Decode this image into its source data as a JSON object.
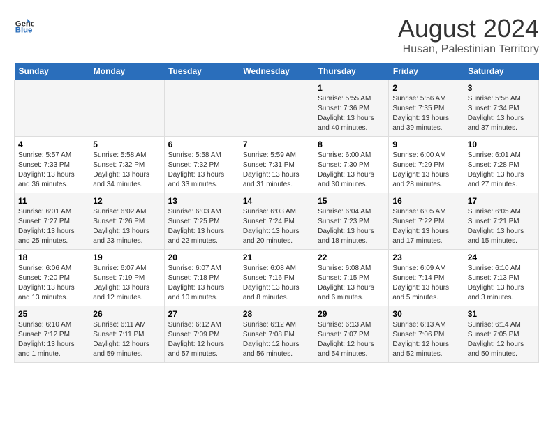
{
  "header": {
    "logo_general": "General",
    "logo_blue": "Blue",
    "main_title": "August 2024",
    "subtitle": "Husan, Palestinian Territory"
  },
  "weekdays": [
    "Sunday",
    "Monday",
    "Tuesday",
    "Wednesday",
    "Thursday",
    "Friday",
    "Saturday"
  ],
  "weeks": [
    [
      {
        "day": "",
        "sunrise": "",
        "sunset": "",
        "daylight": "",
        "empty": true
      },
      {
        "day": "",
        "sunrise": "",
        "sunset": "",
        "daylight": "",
        "empty": true
      },
      {
        "day": "",
        "sunrise": "",
        "sunset": "",
        "daylight": "",
        "empty": true
      },
      {
        "day": "",
        "sunrise": "",
        "sunset": "",
        "daylight": "",
        "empty": true
      },
      {
        "day": "1",
        "sunrise": "5:55 AM",
        "sunset": "7:36 PM",
        "daylight": "13 hours and 40 minutes.",
        "empty": false
      },
      {
        "day": "2",
        "sunrise": "5:56 AM",
        "sunset": "7:35 PM",
        "daylight": "13 hours and 39 minutes.",
        "empty": false
      },
      {
        "day": "3",
        "sunrise": "5:56 AM",
        "sunset": "7:34 PM",
        "daylight": "13 hours and 37 minutes.",
        "empty": false
      }
    ],
    [
      {
        "day": "4",
        "sunrise": "5:57 AM",
        "sunset": "7:33 PM",
        "daylight": "13 hours and 36 minutes.",
        "empty": false
      },
      {
        "day": "5",
        "sunrise": "5:58 AM",
        "sunset": "7:32 PM",
        "daylight": "13 hours and 34 minutes.",
        "empty": false
      },
      {
        "day": "6",
        "sunrise": "5:58 AM",
        "sunset": "7:32 PM",
        "daylight": "13 hours and 33 minutes.",
        "empty": false
      },
      {
        "day": "7",
        "sunrise": "5:59 AM",
        "sunset": "7:31 PM",
        "daylight": "13 hours and 31 minutes.",
        "empty": false
      },
      {
        "day": "8",
        "sunrise": "6:00 AM",
        "sunset": "7:30 PM",
        "daylight": "13 hours and 30 minutes.",
        "empty": false
      },
      {
        "day": "9",
        "sunrise": "6:00 AM",
        "sunset": "7:29 PM",
        "daylight": "13 hours and 28 minutes.",
        "empty": false
      },
      {
        "day": "10",
        "sunrise": "6:01 AM",
        "sunset": "7:28 PM",
        "daylight": "13 hours and 27 minutes.",
        "empty": false
      }
    ],
    [
      {
        "day": "11",
        "sunrise": "6:01 AM",
        "sunset": "7:27 PM",
        "daylight": "13 hours and 25 minutes.",
        "empty": false
      },
      {
        "day": "12",
        "sunrise": "6:02 AM",
        "sunset": "7:26 PM",
        "daylight": "13 hours and 23 minutes.",
        "empty": false
      },
      {
        "day": "13",
        "sunrise": "6:03 AM",
        "sunset": "7:25 PM",
        "daylight": "13 hours and 22 minutes.",
        "empty": false
      },
      {
        "day": "14",
        "sunrise": "6:03 AM",
        "sunset": "7:24 PM",
        "daylight": "13 hours and 20 minutes.",
        "empty": false
      },
      {
        "day": "15",
        "sunrise": "6:04 AM",
        "sunset": "7:23 PM",
        "daylight": "13 hours and 18 minutes.",
        "empty": false
      },
      {
        "day": "16",
        "sunrise": "6:05 AM",
        "sunset": "7:22 PM",
        "daylight": "13 hours and 17 minutes.",
        "empty": false
      },
      {
        "day": "17",
        "sunrise": "6:05 AM",
        "sunset": "7:21 PM",
        "daylight": "13 hours and 15 minutes.",
        "empty": false
      }
    ],
    [
      {
        "day": "18",
        "sunrise": "6:06 AM",
        "sunset": "7:20 PM",
        "daylight": "13 hours and 13 minutes.",
        "empty": false
      },
      {
        "day": "19",
        "sunrise": "6:07 AM",
        "sunset": "7:19 PM",
        "daylight": "13 hours and 12 minutes.",
        "empty": false
      },
      {
        "day": "20",
        "sunrise": "6:07 AM",
        "sunset": "7:18 PM",
        "daylight": "13 hours and 10 minutes.",
        "empty": false
      },
      {
        "day": "21",
        "sunrise": "6:08 AM",
        "sunset": "7:16 PM",
        "daylight": "13 hours and 8 minutes.",
        "empty": false
      },
      {
        "day": "22",
        "sunrise": "6:08 AM",
        "sunset": "7:15 PM",
        "daylight": "13 hours and 6 minutes.",
        "empty": false
      },
      {
        "day": "23",
        "sunrise": "6:09 AM",
        "sunset": "7:14 PM",
        "daylight": "13 hours and 5 minutes.",
        "empty": false
      },
      {
        "day": "24",
        "sunrise": "6:10 AM",
        "sunset": "7:13 PM",
        "daylight": "13 hours and 3 minutes.",
        "empty": false
      }
    ],
    [
      {
        "day": "25",
        "sunrise": "6:10 AM",
        "sunset": "7:12 PM",
        "daylight": "13 hours and 1 minute.",
        "empty": false
      },
      {
        "day": "26",
        "sunrise": "6:11 AM",
        "sunset": "7:11 PM",
        "daylight": "12 hours and 59 minutes.",
        "empty": false
      },
      {
        "day": "27",
        "sunrise": "6:12 AM",
        "sunset": "7:09 PM",
        "daylight": "12 hours and 57 minutes.",
        "empty": false
      },
      {
        "day": "28",
        "sunrise": "6:12 AM",
        "sunset": "7:08 PM",
        "daylight": "12 hours and 56 minutes.",
        "empty": false
      },
      {
        "day": "29",
        "sunrise": "6:13 AM",
        "sunset": "7:07 PM",
        "daylight": "12 hours and 54 minutes.",
        "empty": false
      },
      {
        "day": "30",
        "sunrise": "6:13 AM",
        "sunset": "7:06 PM",
        "daylight": "12 hours and 52 minutes.",
        "empty": false
      },
      {
        "day": "31",
        "sunrise": "6:14 AM",
        "sunset": "7:05 PM",
        "daylight": "12 hours and 50 minutes.",
        "empty": false
      }
    ]
  ],
  "labels": {
    "sunrise": "Sunrise:",
    "sunset": "Sunset:",
    "daylight": "Daylight:"
  }
}
